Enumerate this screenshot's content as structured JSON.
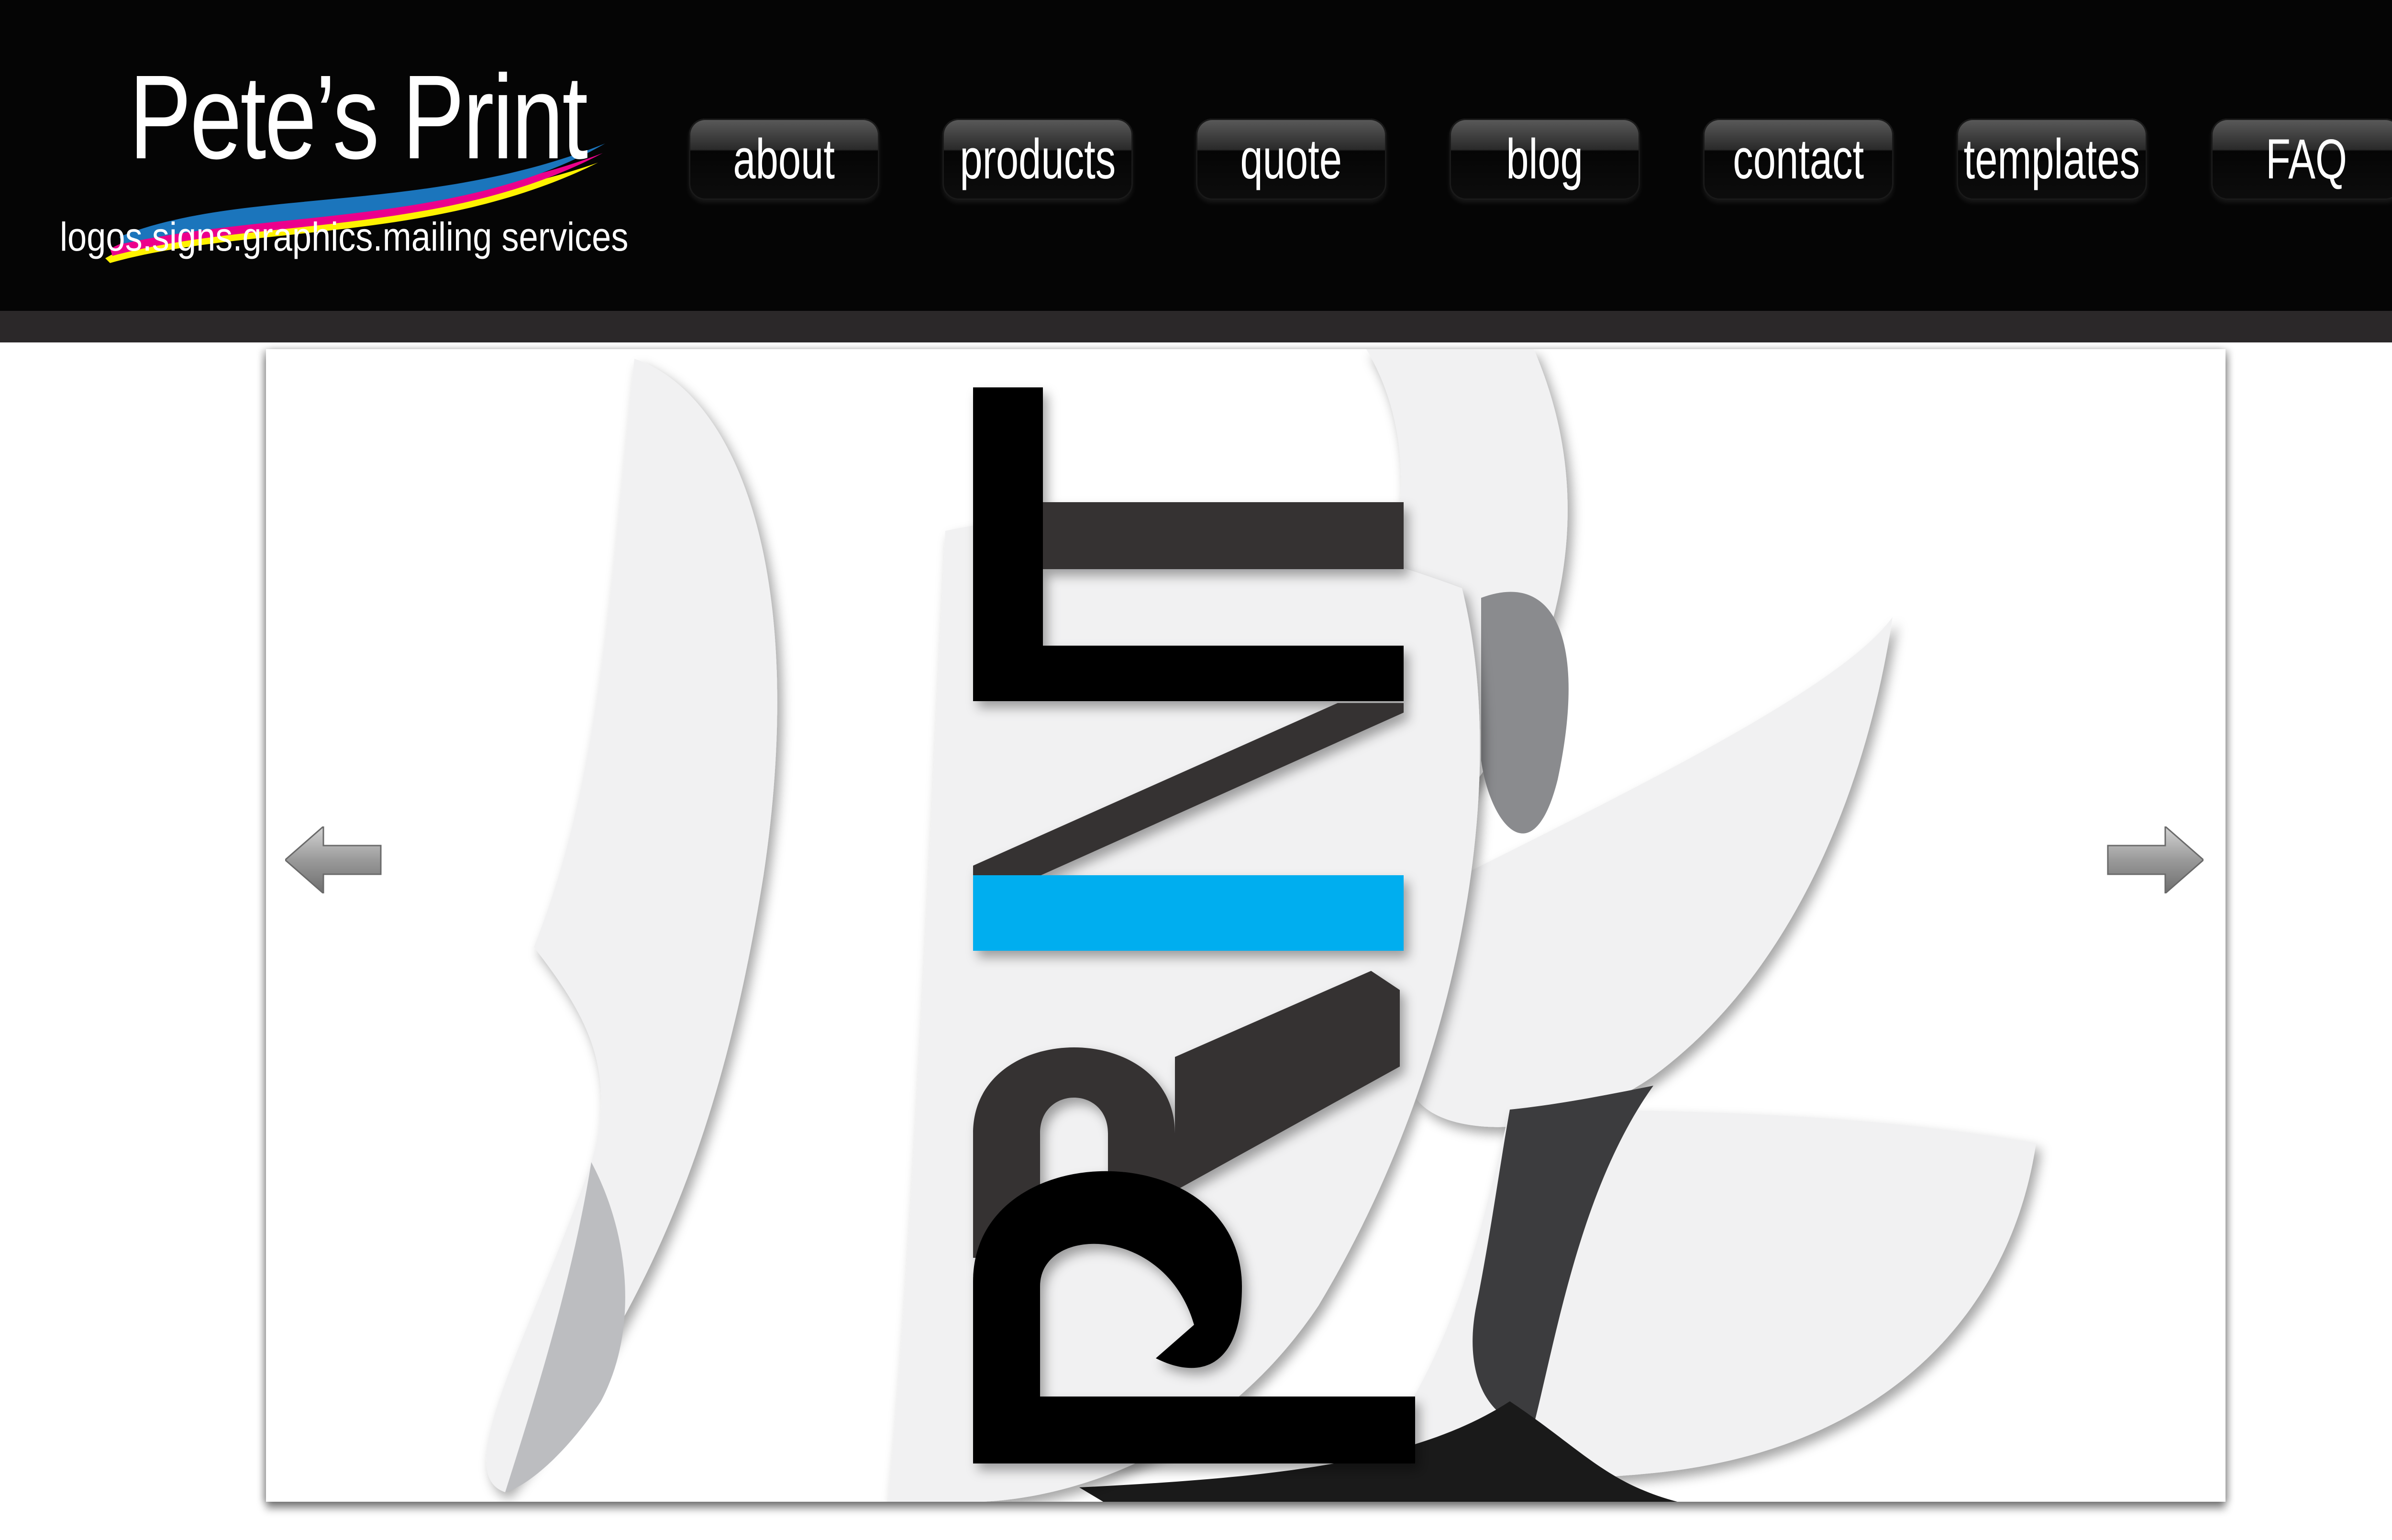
{
  "brand": {
    "title": "Pete’s Print",
    "tagline": "logos.signs.graphics.mailing services",
    "swoosh_colors": [
      "#1b75bc",
      "#ec008c",
      "#fff200"
    ]
  },
  "nav": {
    "items": [
      {
        "label": "about"
      },
      {
        "label": "products"
      },
      {
        "label": "quote"
      },
      {
        "label": "blog"
      },
      {
        "label": "contact"
      },
      {
        "label": "templates"
      },
      {
        "label": "FAQ"
      }
    ]
  },
  "slideshow": {
    "prev_icon": "arrow-left-icon",
    "next_icon": "arrow-right-icon",
    "slide_word": "PRINT",
    "accent_color": "#00aeef"
  },
  "colors": {
    "header_bg": "#050505",
    "strip": "#2b2829",
    "paper": "#f1f1f2",
    "paper_back": "#bcbdc0",
    "letter_dark": "#343233",
    "letter_black": "#050505"
  }
}
